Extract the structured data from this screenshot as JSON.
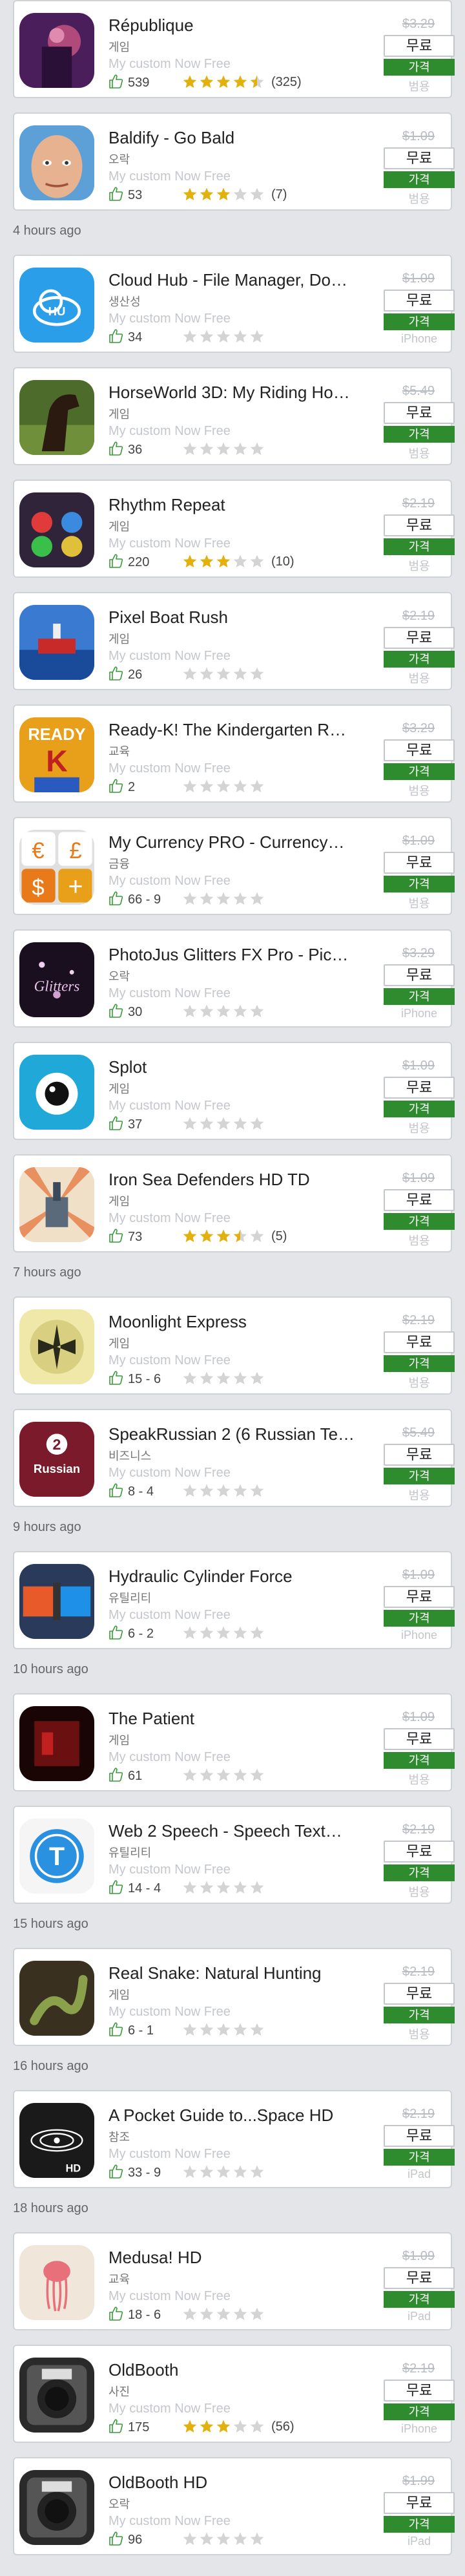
{
  "ui": {
    "custom_label": "My custom Now Free",
    "free_label": "무료",
    "price_button_label": "가격",
    "star_color": "#e2b10d",
    "button_green": "#2e8b2e"
  },
  "apps": [
    {
      "title": "République",
      "category": "게임",
      "likes": "539",
      "rating": 4.5,
      "rating_count": "(325)",
      "old_price": "$3.29",
      "device": "범용",
      "icon": "republique-icon",
      "ts": ""
    },
    {
      "title": "Baldify - Go Bald",
      "category": "오락",
      "likes": "53",
      "rating": 3,
      "rating_count": "(7)",
      "old_price": "$1.09",
      "device": "범용",
      "icon": "bald-face-icon",
      "ts": "4 hours ago"
    },
    {
      "title": "Cloud Hub - File Manager, Do…",
      "category": "생산성",
      "likes": "34",
      "rating": 0,
      "rating_count": "",
      "old_price": "$1.09",
      "device": "iPhone",
      "icon": "cloud-hub-icon",
      "ts": ""
    },
    {
      "title": "HorseWorld 3D: My Riding Ho…",
      "category": "게임",
      "likes": "36",
      "rating": 0,
      "rating_count": "",
      "old_price": "$5.49",
      "device": "범용",
      "icon": "horse-icon",
      "ts": ""
    },
    {
      "title": "Rhythm Repeat",
      "category": "게임",
      "likes": "220",
      "rating": 3,
      "rating_count": "(10)",
      "old_price": "$2.19",
      "device": "범용",
      "icon": "rhythm-drums-icon",
      "ts": ""
    },
    {
      "title": "Pixel Boat Rush",
      "category": "게임",
      "likes": "26",
      "rating": 0,
      "rating_count": "",
      "old_price": "$2.19",
      "device": "범용",
      "icon": "pixel-boat-icon",
      "ts": ""
    },
    {
      "title": "Ready-K! The Kindergarten R…",
      "category": "교육",
      "likes": "2",
      "rating": 0,
      "rating_count": "",
      "old_price": "$3.29",
      "device": "범용",
      "icon": "ready-k-icon",
      "ts": ""
    },
    {
      "title": "My Currency PRO - Currency…",
      "category": "금융",
      "likes": "66 - 9",
      "rating": 0,
      "rating_count": "",
      "old_price": "$1.09",
      "device": "범용",
      "icon": "currency-icon",
      "ts": ""
    },
    {
      "title": "PhotoJus Glitters FX Pro - Pic…",
      "category": "오락",
      "likes": "30",
      "rating": 0,
      "rating_count": "",
      "old_price": "$3.29",
      "device": "iPhone",
      "icon": "glitters-icon",
      "ts": ""
    },
    {
      "title": "Splot",
      "category": "게임",
      "likes": "37",
      "rating": 0,
      "rating_count": "",
      "old_price": "$1.09",
      "device": "범용",
      "icon": "splot-eye-icon",
      "ts": ""
    },
    {
      "title": "Iron Sea Defenders HD TD",
      "category": "게임",
      "likes": "73",
      "rating": 3.5,
      "rating_count": "(5)",
      "old_price": "$1.09",
      "device": "범용",
      "icon": "iron-sea-icon",
      "ts": "7 hours ago"
    },
    {
      "title": "Moonlight Express",
      "category": "게임",
      "likes": "15 - 6",
      "rating": 0,
      "rating_count": "",
      "old_price": "$2.19",
      "device": "범용",
      "icon": "moonlight-icon",
      "ts": ""
    },
    {
      "title": "SpeakRussian 2 (6 Russian Te…",
      "category": "비즈니스",
      "likes": "8 - 4",
      "rating": 0,
      "rating_count": "",
      "old_price": "$5.49",
      "device": "범용",
      "icon": "speak-russian-icon",
      "ts": "9 hours ago"
    },
    {
      "title": "Hydraulic Cylinder Force",
      "category": "유틸리티",
      "likes": "6 - 2",
      "rating": 0,
      "rating_count": "",
      "old_price": "$1.09",
      "device": "iPhone",
      "icon": "hydraulic-icon",
      "ts": "10 hours ago"
    },
    {
      "title": "The Patient",
      "category": "게임",
      "likes": "61",
      "rating": 0,
      "rating_count": "",
      "old_price": "$1.09",
      "device": "범용",
      "icon": "patient-icon",
      "ts": ""
    },
    {
      "title": "Web 2 Speech - Speech Text…",
      "category": "유틸리티",
      "likes": "14 - 4",
      "rating": 0,
      "rating_count": "",
      "old_price": "$2.19",
      "device": "범용",
      "icon": "web2speech-icon",
      "ts": "15 hours ago"
    },
    {
      "title": "Real Snake: Natural Hunting",
      "category": "게임",
      "likes": "6 - 1",
      "rating": 0,
      "rating_count": "",
      "old_price": "$2.19",
      "device": "범용",
      "icon": "snake-icon",
      "ts": "16 hours ago"
    },
    {
      "title": "A Pocket Guide to...Space HD",
      "category": "참조",
      "likes": "33 - 9",
      "rating": 0,
      "rating_count": "",
      "old_price": "$2.19",
      "device": "iPad",
      "icon": "space-guide-icon",
      "ts": "18 hours ago"
    },
    {
      "title": "Medusa! HD",
      "category": "교육",
      "likes": "18 - 6",
      "rating": 0,
      "rating_count": "",
      "old_price": "$1.09",
      "device": "iPad",
      "icon": "medusa-icon",
      "ts": ""
    },
    {
      "title": "OldBooth",
      "category": "사진",
      "likes": "175",
      "rating": 3,
      "rating_count": "(56)",
      "old_price": "$2.19",
      "device": "iPhone",
      "icon": "oldbooth-camera-icon",
      "ts": ""
    },
    {
      "title": "OldBooth HD",
      "category": "오락",
      "likes": "96",
      "rating": 0,
      "rating_count": "",
      "old_price": "$1.99",
      "device": "iPad",
      "icon": "oldbooth-camera-icon",
      "ts": ""
    }
  ]
}
